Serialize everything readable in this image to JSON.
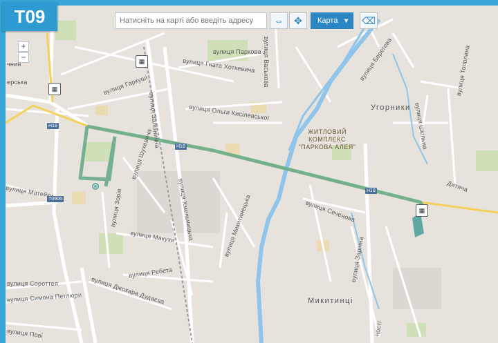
{
  "route": {
    "number": "T09"
  },
  "toolbar": {
    "search_placeholder": "Натисніть на карті або введіть адресу",
    "fullscreen_icon": "expand-icon",
    "locate_icon": "crosshair-move-icon",
    "maptype_label": "Карта",
    "eraser_icon": "eraser-icon"
  },
  "zoom": {
    "in": "+",
    "out": "−"
  },
  "colors": {
    "route": "#6fae8c",
    "road_major": "#f4d15a",
    "water": "#8fc5ea",
    "frame": "#3aa6d8"
  },
  "highway": {
    "h18": "H18",
    "t0906": "T0906"
  },
  "streets": {
    "paskova": "вулиця Паркова",
    "vasylkova": "вулиця Васькова",
    "khotkevycha": "вулиця Гната Хоткевича",
    "garkushi": "вулиця Гаркуші",
    "zaliznychna": "вулиця Залізнична",
    "kysilevskoi": "вулиця Ольги Кисілевської",
    "berehova": "вулиця Берегова",
    "shkilna": "вулиця Шкільна",
    "topolyna": "вулиця Тополина",
    "dytiacha": "Дитяча",
    "shukhevycha": "вулиця Шухевича",
    "zorii": "вулиця Зорія",
    "khmelnytska": "вулиця Хмельницька",
    "mykytynetska": "вулиця Микитинецька",
    "sechenova": "вулиця Сеченова",
    "zarichna": "вулиця Зарічна",
    "matyeyky": "вулиця Матейки",
    "makukh": "вулиця Макухи",
    "rebeta": "вулиця Ребета",
    "sorotei": "вулиця Сороттея",
    "petliury": "вулиця Симона Петлюри",
    "dudaieva": "вулиця Джохара Дудаєва",
    "povi": "вулиця Пові",
    "chyskr": "чнин",
    "vska": "ерська",
    "nosti": "ності"
  },
  "places": {
    "uhornyky": "Угорники",
    "mykytyntsi": "Микитинці",
    "complex": "ЖИТЛОВИЙ КОМПЛЕКС \"ПАРКОВА АЛЕЯ\""
  }
}
